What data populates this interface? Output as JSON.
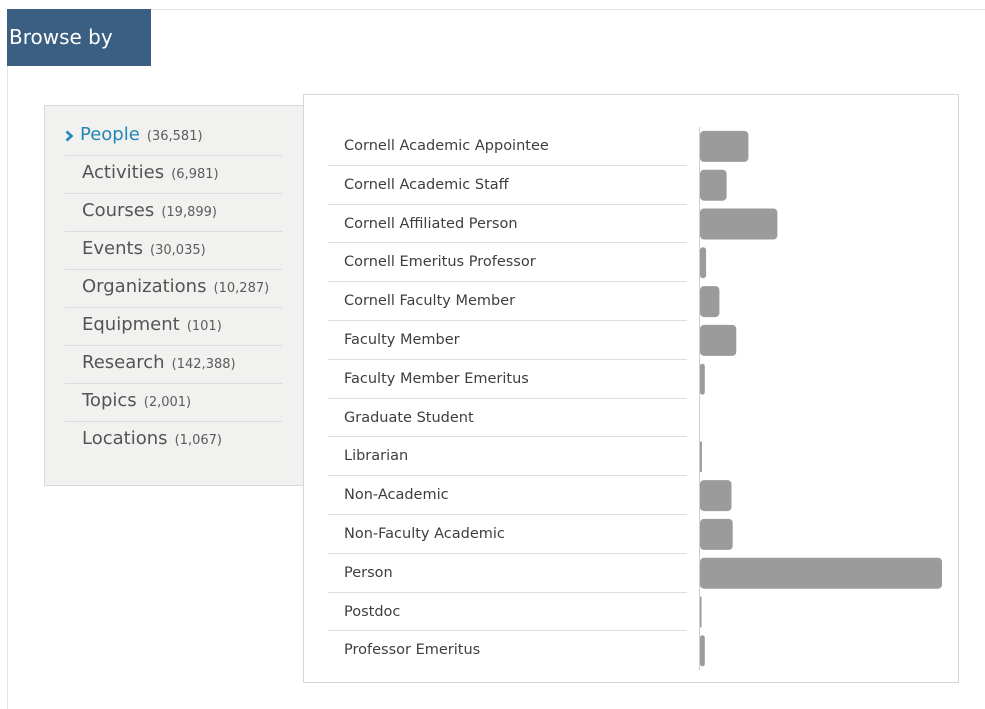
{
  "header": {
    "title": "Browse by"
  },
  "nav": {
    "items": [
      {
        "label": "People",
        "count": "(36,581)",
        "active": true
      },
      {
        "label": "Activities",
        "count": "(6,981)"
      },
      {
        "label": "Courses",
        "count": "(19,899)"
      },
      {
        "label": "Events",
        "count": "(30,035)"
      },
      {
        "label": "Organizations",
        "count": "(10,287)"
      },
      {
        "label": "Equipment",
        "count": "(101)"
      },
      {
        "label": "Research",
        "count": "(142,388)"
      },
      {
        "label": "Topics",
        "count": "(2,001)"
      },
      {
        "label": "Locations",
        "count": "(1,067)"
      }
    ]
  },
  "classes": {
    "items": [
      "Cornell Academic Appointee",
      "Cornell Academic Staff",
      "Cornell Affiliated Person",
      "Cornell Emeritus Professor",
      "Cornell Faculty Member",
      "Faculty Member",
      "Faculty Member Emeritus",
      "Graduate Student",
      "Librarian",
      "Non-Academic",
      "Non-Faculty Academic",
      "Person",
      "Postdoc",
      "Professor Emeritus"
    ]
  },
  "chart_data": {
    "type": "bar",
    "orientation": "horizontal",
    "categories": [
      "Cornell Academic Appointee",
      "Cornell Academic Staff",
      "Cornell Affiliated Person",
      "Cornell Emeritus Professor",
      "Cornell Faculty Member",
      "Faculty Member",
      "Faculty Member Emeritus",
      "Graduate Student",
      "Librarian",
      "Non-Academic",
      "Non-Faculty Academic",
      "Person",
      "Postdoc",
      "Professor Emeritus"
    ],
    "values": [
      0.2,
      0.11,
      0.32,
      0.025,
      0.08,
      0.15,
      0.02,
      0.0,
      0.008,
      0.13,
      0.135,
      1.0,
      0.006,
      0.02
    ],
    "value_unit": "fraction of largest bar",
    "bar_color": "#9b9b9b",
    "axis_color": "#cfcfcf"
  }
}
